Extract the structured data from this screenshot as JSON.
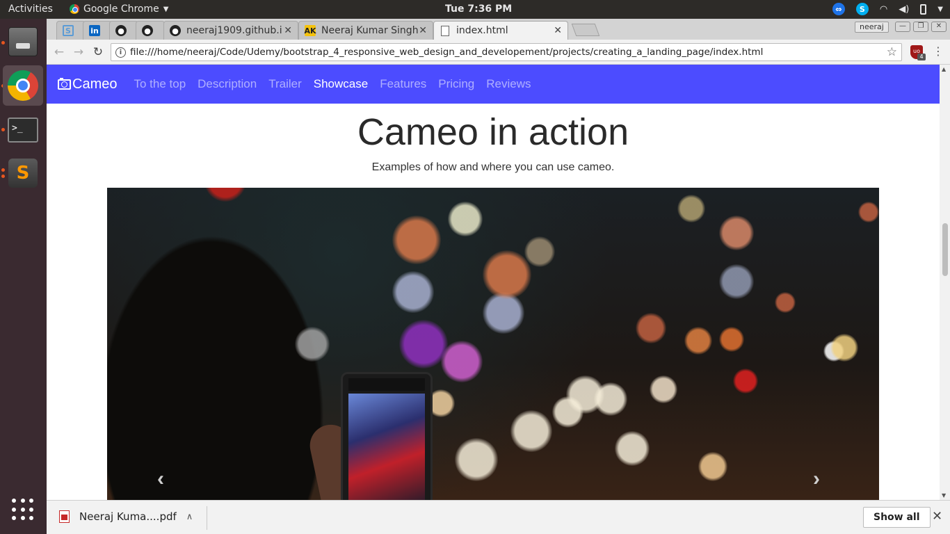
{
  "system": {
    "activities": "Activities",
    "app_menu": "Google Chrome",
    "clock": "Tue  7:36 PM"
  },
  "chrome": {
    "tabs": [
      {
        "title": "",
        "icon": "s-icon"
      },
      {
        "title": "",
        "icon": "linkedin-icon"
      },
      {
        "title": "",
        "icon": "github-icon"
      },
      {
        "title": "",
        "icon": "github-icon"
      },
      {
        "title": "neeraj1909.github.i",
        "icon": "github-icon"
      },
      {
        "title": "Neeraj Kumar Singh",
        "icon": "ak-icon"
      },
      {
        "title": "index.html",
        "icon": "document-icon",
        "active": true
      }
    ],
    "profile": "neeraj",
    "url": "file:///home/neeraj/Code/Udemy/bootstrap_4_responsive_web_design_and_developement/projects/creating_a_landing_page/index.html",
    "extension_badge": "4",
    "extension_label": "uo"
  },
  "page": {
    "brand": "Cameo",
    "nav": [
      {
        "label": "To the top",
        "active": false
      },
      {
        "label": "Description",
        "active": false
      },
      {
        "label": "Trailer",
        "active": false
      },
      {
        "label": "Showcase",
        "active": true
      },
      {
        "label": "Features",
        "active": false
      },
      {
        "label": "Pricing",
        "active": false
      },
      {
        "label": "Reviews",
        "active": false
      }
    ],
    "section_title": "Cameo in action",
    "section_subtitle": "Examples of how and where you can use cameo.",
    "nav_color": "#4c4cff"
  },
  "downloads": {
    "file": "Neeraj Kuma....pdf",
    "show_all": "Show all"
  }
}
